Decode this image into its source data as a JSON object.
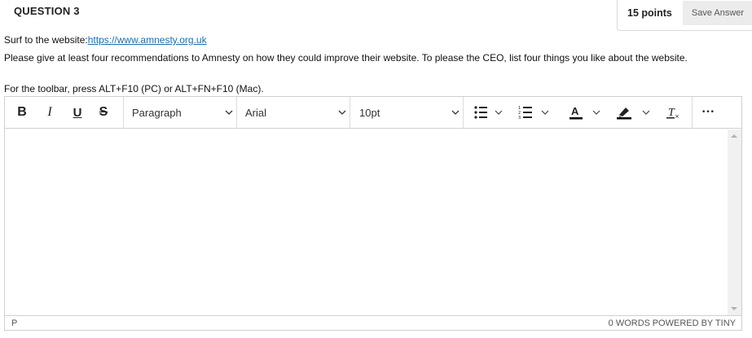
{
  "question": {
    "title": "QUESTION 3",
    "points": "15 points",
    "save_label": "Save Answer",
    "surf_prefix": "Surf to the website:",
    "surf_link": "https://www.amnesty.org.uk",
    "body": "Please give at least four recommendations to Amnesty on how they could improve their website. To please the CEO, list four things you like about the website.",
    "toolbar_hint": "For the toolbar, press ALT+F10 (PC) or ALT+FN+F10 (Mac)."
  },
  "toolbar": {
    "bold": "B",
    "italic": "I",
    "underline": "U",
    "strike": "S",
    "block_format": "Paragraph",
    "font_family": "Arial",
    "font_size": "10pt",
    "more": "•••",
    "icons": [
      "bold-icon",
      "italic-icon",
      "underline-icon",
      "strikethrough-icon",
      "bullet-list-icon",
      "numbered-list-icon",
      "text-color-icon",
      "highlight-icon",
      "clear-formatting-icon",
      "more-icon"
    ],
    "text_color": "#000000"
  },
  "statusbar": {
    "path": "P",
    "words": "0 WORDS",
    "brand": "POWERED BY TINY"
  }
}
